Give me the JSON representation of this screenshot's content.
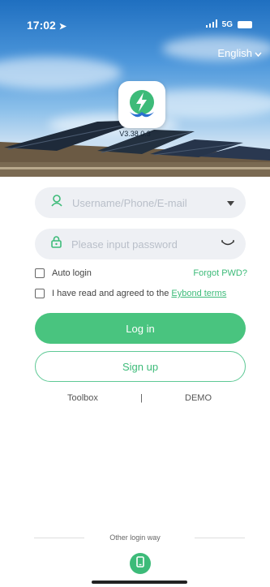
{
  "status_bar": {
    "time": "17:02",
    "network": "5G"
  },
  "language": {
    "label": "English"
  },
  "app": {
    "version": "V3.38.0.3"
  },
  "username": {
    "placeholder": "Username/Phone/E-mail"
  },
  "password": {
    "placeholder": "Please input password"
  },
  "auto_login": {
    "label": "Auto login"
  },
  "forgot": {
    "label": "Forgot PWD?"
  },
  "terms": {
    "prefix": "I have read and agreed to the ",
    "link": "Eybond terms"
  },
  "buttons": {
    "login": "Log in",
    "signup": "Sign up"
  },
  "tools": {
    "toolbox": "Toolbox",
    "divider": "|",
    "demo": "DEMO"
  },
  "other_login": {
    "label": "Other login way"
  },
  "colors": {
    "accent": "#49c47f",
    "field_bg": "#eef0f4"
  }
}
